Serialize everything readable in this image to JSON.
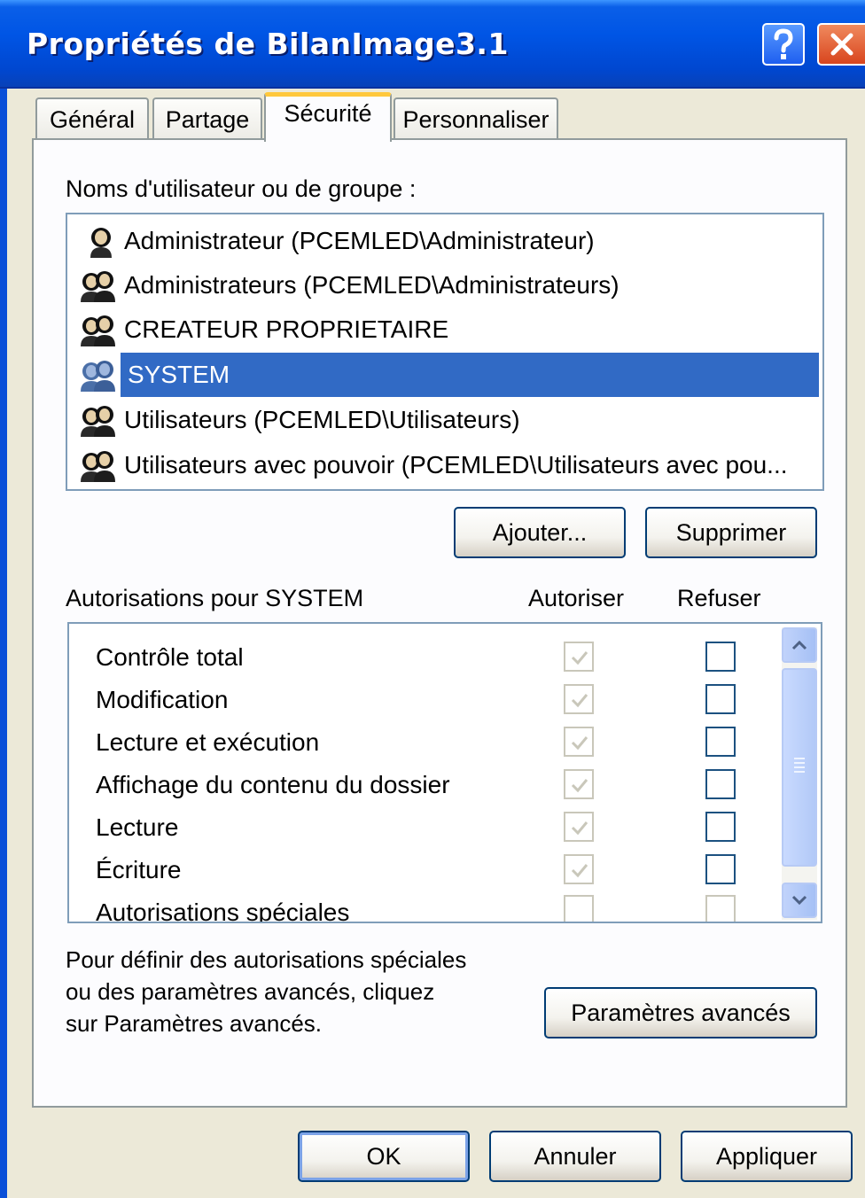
{
  "window": {
    "title": "Propriétés de BilanImage3.1",
    "help_label": "?",
    "close_label": "X"
  },
  "tabs": [
    {
      "label": "Général"
    },
    {
      "label": "Partage"
    },
    {
      "label": "Sécurité",
      "active": true
    },
    {
      "label": "Personnaliser"
    }
  ],
  "users": {
    "heading": "Noms d'utilisateur ou de groupe :",
    "items": [
      {
        "label": "Administrateur (PCEMLED\\Administrateur)",
        "icon": "user-icon"
      },
      {
        "label": "Administrateurs (PCEMLED\\Administrateurs)",
        "icon": "group-icon"
      },
      {
        "label": "CREATEUR PROPRIETAIRE",
        "icon": "group-icon"
      },
      {
        "label": "SYSTEM",
        "icon": "group-icon",
        "selected": true
      },
      {
        "label": "Utilisateurs (PCEMLED\\Utilisateurs)",
        "icon": "group-icon"
      },
      {
        "label": "Utilisateurs avec pouvoir (PCEMLED\\Utilisateurs avec pou...",
        "icon": "group-icon"
      }
    ],
    "add_button": "Ajouter...",
    "remove_button": "Supprimer"
  },
  "permissions": {
    "heading": "Autorisations pour SYSTEM",
    "allow_header": "Autoriser",
    "deny_header": "Refuser",
    "rows": [
      {
        "label": "Contrôle total",
        "allow": true,
        "deny": false
      },
      {
        "label": "Modification",
        "allow": true,
        "deny": false
      },
      {
        "label": "Lecture et exécution",
        "allow": true,
        "deny": false
      },
      {
        "label": "Affichage du contenu du dossier",
        "allow": true,
        "deny": false
      },
      {
        "label": "Lecture",
        "allow": true,
        "deny": false
      },
      {
        "label": "Écriture",
        "allow": true,
        "deny": false
      },
      {
        "label": "Autorisations spéciales",
        "allow": false,
        "deny": false
      }
    ]
  },
  "advanced": {
    "description_line1": "Pour définir des autorisations spéciales",
    "description_line2": "ou des paramètres avancés, cliquez",
    "description_line3": "sur Paramètres avancés.",
    "button": "Paramètres avancés"
  },
  "footer": {
    "ok": "OK",
    "cancel": "Annuler",
    "apply": "Appliquer"
  },
  "colors": {
    "titlebar": "#0055e5",
    "selection": "#316ac5",
    "active_tab_accent": "#ffc83c"
  }
}
